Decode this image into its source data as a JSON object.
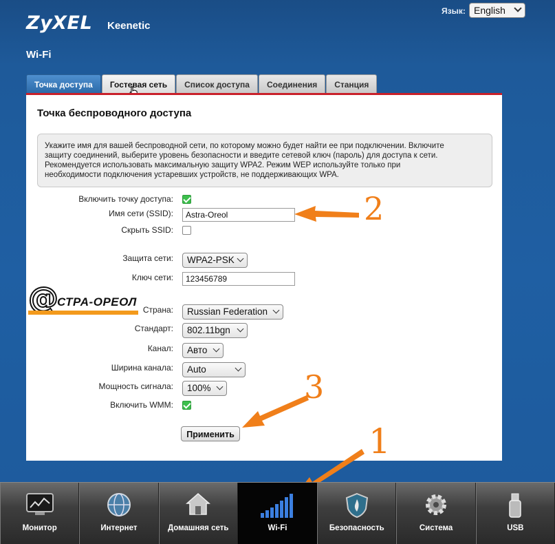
{
  "header": {
    "brand": "ZyXEL",
    "product": "Keenetic",
    "language_label": "Язык:",
    "language_value": "English"
  },
  "section_title": "Wi-Fi",
  "tabs": [
    {
      "label": "Точка доступа",
      "active": true
    },
    {
      "label": "Гостевая сеть",
      "active": false
    },
    {
      "label": "Список доступа",
      "active": false
    },
    {
      "label": "Соединения",
      "active": false
    },
    {
      "label": "Станция",
      "active": false
    }
  ],
  "panel": {
    "title": "Точка беспроводного доступа",
    "info_lines": [
      "Укажите имя для вашей беспроводной сети, по которому можно будет найти ее при подключении. Включите",
      "защиту соединений, выберите уровень безопасности и введите сетевой ключ (пароль) для доступа к сети.",
      "Рекомендуется использовать максимальную защиту WPA2. Режим WEP используйте только при",
      "необходимости подключения устаревших устройств, не поддерживающих WPA."
    ]
  },
  "form": {
    "enable_ap": {
      "label": "Включить точку доступа:",
      "checked": true
    },
    "ssid": {
      "label": "Имя сети (SSID):",
      "value": "Astra-Oreol"
    },
    "hide_ssid": {
      "label": "Скрыть SSID:",
      "checked": false
    },
    "security": {
      "label": "Защита сети:",
      "value": "WPA2-PSK"
    },
    "key": {
      "label": "Ключ сети:",
      "value": "123456789"
    },
    "country": {
      "label": "Страна:",
      "value": "Russian Federation"
    },
    "standard": {
      "label": "Стандарт:",
      "value": "802.11bgn"
    },
    "channel": {
      "label": "Канал:",
      "value": "Авто"
    },
    "bandwidth": {
      "label": "Ширина канала:",
      "value": "Auto"
    },
    "power": {
      "label": "Мощность сигнала:",
      "value": "100%"
    },
    "wmm": {
      "label": "Включить WMM:",
      "checked": true
    },
    "apply_label": "Применить"
  },
  "watermark": {
    "at": "@",
    "text": "СТРА-ОРЕОЛ"
  },
  "annotations": {
    "one": "1",
    "two": "2",
    "three": "3",
    "color": "#f07f1a"
  },
  "nav": [
    {
      "label": "Монитор",
      "icon": "monitor-icon"
    },
    {
      "label": "Интернет",
      "icon": "globe-icon"
    },
    {
      "label": "Домашняя сеть",
      "icon": "house-icon"
    },
    {
      "label": "Wi-Fi",
      "icon": "wifi-bars-icon",
      "active": true
    },
    {
      "label": "Безопасность",
      "icon": "shield-icon"
    },
    {
      "label": "Система",
      "icon": "gear-icon"
    },
    {
      "label": "USB",
      "icon": "usb-icon"
    }
  ]
}
